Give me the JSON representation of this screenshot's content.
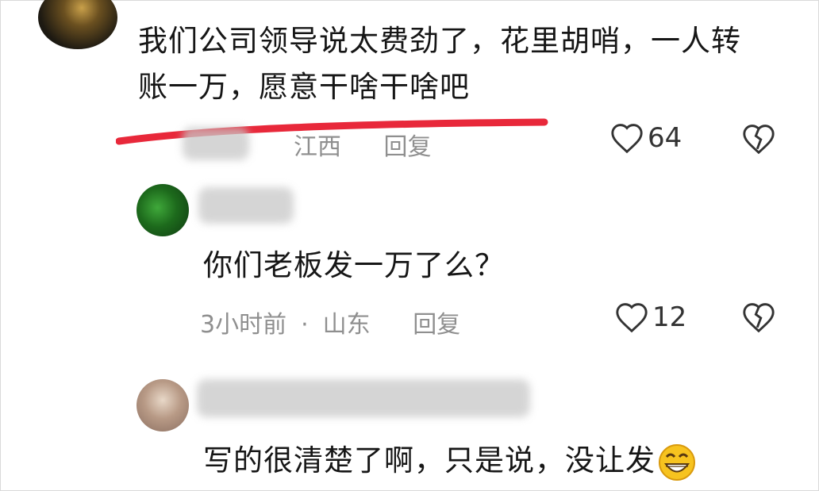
{
  "comments": [
    {
      "content": "我们公司领导说太费劲了，花里胡哨，一人转账一万，愿意干啥干啥吧",
      "location": "江西",
      "reply_label": "回复",
      "likes": "64"
    },
    {
      "content": "你们老板发一万了么？",
      "time": "3小时前",
      "separator": "·",
      "location": "山东",
      "reply_label": "回复",
      "likes": "12"
    },
    {
      "content": "写的很清楚了啊，只是说，没让发",
      "emoji": "grinning-face-emoji"
    }
  ],
  "colors": {
    "underline": "#e8283a",
    "meta_text": "#8f8f8f",
    "emoji": "#f7c31f"
  }
}
